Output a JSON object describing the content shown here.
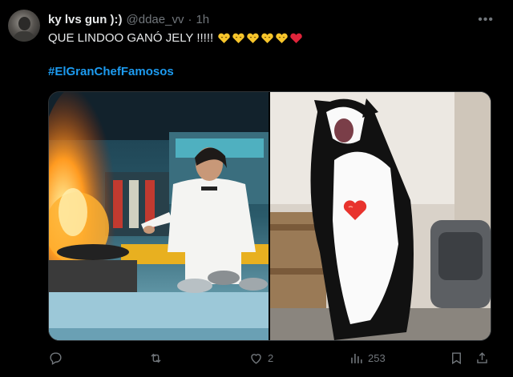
{
  "post": {
    "display_name": "ky lvs gun ):)",
    "handle": "@ddae_vv",
    "separator": "·",
    "time": "1h",
    "more_label": "•••",
    "text": "QUE LINDOO GANÓ JELY !!!!!",
    "emoji_sequence": [
      "yellow-heart-face",
      "yellow-heart-face",
      "yellow-heart-face",
      "yellow-heart-face",
      "yellow-heart-face",
      "red-heart"
    ],
    "hashtag": "#ElGranChefFamosos"
  },
  "media": [
    {
      "name": "chef-kitchen-photo",
      "description_icon": "photo"
    },
    {
      "name": "cat-photo",
      "description_icon": "photo"
    }
  ],
  "actions": {
    "reply": {
      "icon": "reply-icon",
      "count": ""
    },
    "repost": {
      "icon": "repost-icon",
      "count": ""
    },
    "like": {
      "icon": "heart-icon",
      "count": "2"
    },
    "views": {
      "icon": "views-icon",
      "count": "253"
    },
    "bookmark": {
      "icon": "bookmark-icon"
    },
    "share": {
      "icon": "share-icon"
    }
  },
  "colors": {
    "background": "#000000",
    "text": "#e7e9ea",
    "muted": "#71767b",
    "link": "#1d9bf0",
    "heart_red": "#f91880",
    "emoji_yellow": "#f7c52b"
  }
}
